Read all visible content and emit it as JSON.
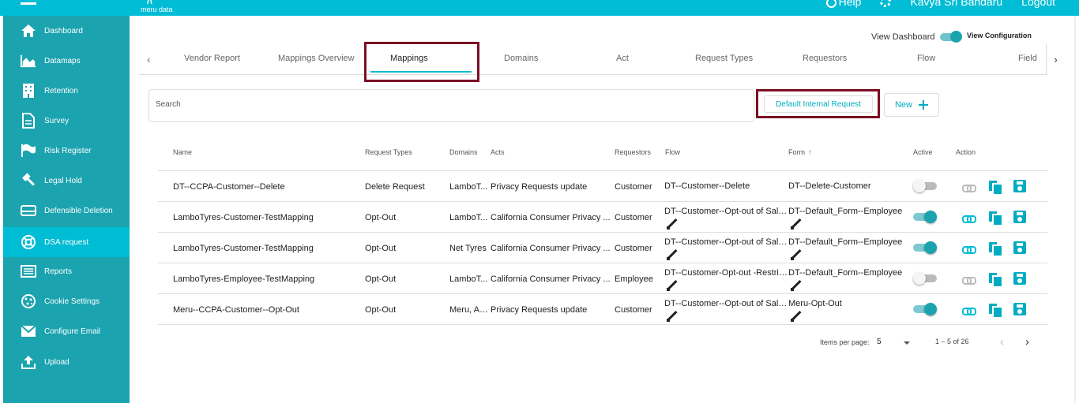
{
  "header": {
    "brand": "meru data",
    "help_label": "Help",
    "user_name": "Kavya Sri Bandaru",
    "logout_label": "Logout",
    "icons": [
      "hamburger-icon",
      "help-icon",
      "gear-icon"
    ]
  },
  "sidebar": {
    "items": [
      {
        "label": "Dashboard",
        "icon": "home-icon"
      },
      {
        "label": "Datamaps",
        "icon": "area-chart-icon"
      },
      {
        "label": "Retention",
        "icon": "building-icon"
      },
      {
        "label": "Survey",
        "icon": "document-icon"
      },
      {
        "label": "Risk Register",
        "icon": "flag-icon"
      },
      {
        "label": "Legal Hold",
        "icon": "gavel-icon"
      },
      {
        "label": "Defensible Deletion",
        "icon": "drive-icon"
      },
      {
        "label": "DSA request",
        "icon": "lifebuoy-icon",
        "active": true
      },
      {
        "label": "Reports",
        "icon": "list-icon"
      },
      {
        "label": "Cookie Settings",
        "icon": "cookie-icon"
      },
      {
        "label": "Configure Email",
        "icon": "mail-icon"
      },
      {
        "label": "Upload",
        "icon": "upload-icon"
      }
    ]
  },
  "view_switch": {
    "dashboard_label": "View Dashboard",
    "configuration_label": "View Configuration",
    "configuration_on": true
  },
  "tabs": {
    "items": [
      "Vendor Report",
      "Mappings Overview",
      "Mappings",
      "Domains",
      "Act",
      "Request Types",
      "Requestors",
      "Flow",
      "Field"
    ],
    "active": "Mappings"
  },
  "search": {
    "placeholder": "Search",
    "value": ""
  },
  "buttons": {
    "default_internal_request": "Default Internal Request",
    "new": "New"
  },
  "table": {
    "headers": {
      "name": "Name",
      "request_types": "Request Types",
      "domains": "Domains",
      "acts": "Acts",
      "requestors": "Requestors",
      "flow": "Flow",
      "form": "Form",
      "active": "Active",
      "action": "Action"
    },
    "rows": [
      {
        "name": "DT--CCPA-Customer--Delete",
        "request_type": "Delete Request",
        "domains": "LamboT...",
        "acts": "Privacy Requests update",
        "requestors": "Customer",
        "flow": "DT--Customer--Delete",
        "form": "DT--Delete-Customer",
        "active": false,
        "editable": false
      },
      {
        "name": "LamboTyres-Customer-TestMapping",
        "request_type": "Opt-Out",
        "domains": "LamboT...",
        "acts": "California Consumer Privacy ...",
        "requestors": "Customer",
        "flow": "DT--Customer--Opt-out of Sale...",
        "form": "DT--Default_Form--Employee",
        "active": true,
        "editable": true
      },
      {
        "name": "LamboTyres-Customer-TestMapping",
        "request_type": "Opt-Out",
        "domains": "Net Tyres",
        "acts": "California Consumer Privacy ...",
        "requestors": "Customer",
        "flow": "DT--Customer--Opt-out of Sale...",
        "form": "DT--Default_Form--Employee",
        "active": true,
        "editable": true
      },
      {
        "name": "LamboTyres-Employee-TestMapping",
        "request_type": "Opt-Out",
        "domains": "LamboT...",
        "acts": "California Consumer Privacy ...",
        "requestors": "Employee",
        "flow": "DT--Customer-Opt-out -Restric...",
        "form": "DT--Default_Form--Employee",
        "active": false,
        "editable": true
      },
      {
        "name": "Meru--CCPA-Customer--Opt-Out",
        "request_type": "Opt-Out",
        "domains": "Meru, An...",
        "acts": "Privacy Requests update",
        "requestors": "Customer",
        "flow": "DT--Customer--Opt-out of Sale...",
        "form": "Meru-Opt-Out",
        "active": true,
        "editable": true
      }
    ]
  },
  "paginator": {
    "items_per_page_label": "Items per page:",
    "page_size": "5",
    "range_label": "1 – 5 of 26"
  },
  "colors": {
    "primary": "#00BCD4",
    "sidebar": "#1BA3AF",
    "highlight_border": "#7B0F24"
  }
}
